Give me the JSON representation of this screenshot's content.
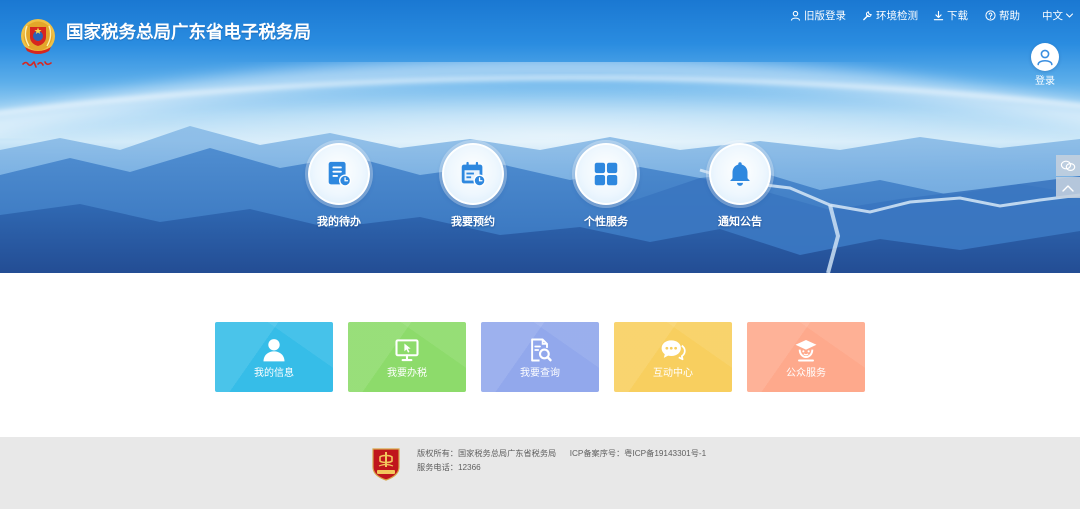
{
  "header": {
    "title": "国家税务总局广东省电子税务局",
    "logo_icon": "tax-emblem-icon"
  },
  "topnav": {
    "old_login": {
      "label": "旧版登录",
      "icon": "user-icon"
    },
    "env_check": {
      "label": "环境检测",
      "icon": "wrench-icon"
    },
    "download": {
      "label": "下载",
      "icon": "download-icon"
    },
    "help": {
      "label": "帮助",
      "icon": "help-icon"
    },
    "language": {
      "label": "中文",
      "icon": "chevron-down-icon"
    }
  },
  "login": {
    "label": "登录",
    "icon": "avatar-icon"
  },
  "quick_entries": [
    {
      "label": "我的待办",
      "icon": "todo-icon"
    },
    {
      "label": "我要预约",
      "icon": "calendar-icon"
    },
    {
      "label": "个性服务",
      "icon": "grid-icon"
    },
    {
      "label": "通知公告",
      "icon": "bell-icon"
    }
  ],
  "side_tools": [
    {
      "icon": "chat-icon"
    },
    {
      "icon": "chevron-up-icon"
    }
  ],
  "tiles": [
    {
      "label": "我的信息",
      "icon": "user-icon",
      "color": "#36bde8"
    },
    {
      "label": "我要办税",
      "icon": "monitor-icon",
      "color": "#8ddb6b"
    },
    {
      "label": "我要查询",
      "icon": "search-document-icon",
      "color": "#92a8ec"
    },
    {
      "label": "互动中心",
      "icon": "chat-bubbles-icon",
      "color": "#f8cf5f"
    },
    {
      "label": "公众服务",
      "icon": "service-person-icon",
      "color": "#fea98c"
    }
  ],
  "footer": {
    "copyright": "版权所有：国家税务总局广东省税务局",
    "icp": "ICP备案序号：粤ICP备19143301号-1",
    "phone": "服务电话：12366",
    "badge_icon": "government-site-badge-icon"
  }
}
